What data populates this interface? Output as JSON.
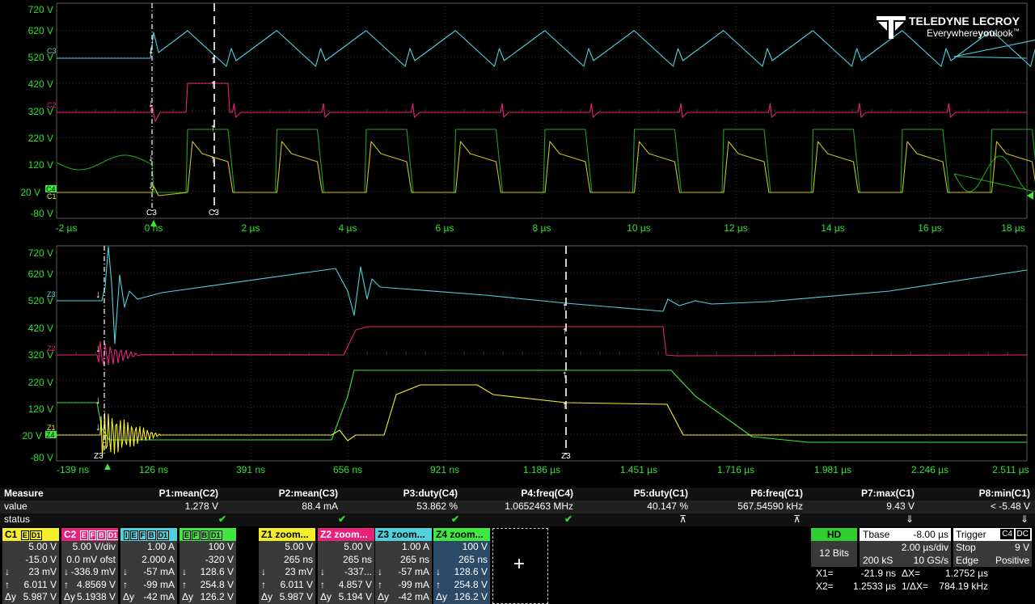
{
  "brand": {
    "name": "TELEDYNE LECROY",
    "tagline_a": "Everywhere",
    "tagline_b": "you",
    "tagline_c": "look",
    "tm": "™"
  },
  "colors": {
    "c1": "#f5ef2a",
    "c2": "#e8227a",
    "c3": "#4fd2de",
    "c4": "#3ee83e",
    "grid": "#5a5a5a",
    "axis": "#2fe02f"
  },
  "top": {
    "y_labels": [
      "720 V",
      "620 V",
      "520 V",
      "420 V",
      "320 V",
      "220 V",
      "120 V",
      "20 V",
      "-80 V"
    ],
    "x_labels": [
      "-2 µs",
      "0 ns",
      "2 µs",
      "4 µs",
      "6 µs",
      "8 µs",
      "10 µs",
      "12 µs",
      "14 µs",
      "16 µs",
      "18 µs"
    ],
    "markers": {
      "c3": "C3",
      "c2": "C2",
      "c4": "C4",
      "c1": "C1"
    },
    "cursor_labels": [
      "C3",
      "C3"
    ]
  },
  "bottom": {
    "y_labels": [
      "720 V",
      "620 V",
      "520 V",
      "420 V",
      "320 V",
      "220 V",
      "120 V",
      "20 V",
      "-80 V"
    ],
    "x_labels": [
      "-139 ns",
      "126 ns",
      "391 ns",
      "656 ns",
      "921 ns",
      "1.186 µs",
      "1.451 µs",
      "1.716 µs",
      "1.981 µs",
      "2.246 µs",
      "2.511 µs"
    ],
    "markers": {
      "z3": "Z3",
      "z2": "Z2",
      "z4": "Z4",
      "z1": "Z1"
    },
    "cursor_labels": [
      "Z3",
      "Z3"
    ]
  },
  "measure": {
    "head_label": "Measure",
    "value_label": "value",
    "status_label": "status",
    "params": [
      {
        "name": "P1:mean(C2)",
        "value": "1.278 V",
        "status": "✔"
      },
      {
        "name": "P2:mean(C3)",
        "value": "88.4 mA",
        "status": "✔"
      },
      {
        "name": "P3:duty(C4)",
        "value": "53.862 %",
        "status": "✔"
      },
      {
        "name": "P4:freq(C4)",
        "value": "1.0652463 MHz",
        "status": "✔"
      },
      {
        "name": "P5:duty(C1)",
        "value": "40.147 %",
        "status": "⊼"
      },
      {
        "name": "P6:freq(C1)",
        "value": "567.54590 kHz",
        "status": "⊼"
      },
      {
        "name": "P7:max(C1)",
        "value": "9.43 V",
        "status": "⇓"
      },
      {
        "name": "P8:min(C1)",
        "value": "< -5.48 V",
        "status": "⇓"
      }
    ]
  },
  "channels": [
    {
      "title": "C1",
      "tags": [
        "E",
        "D1"
      ],
      "color": "#f5ef2a",
      "rows": [
        [
          "",
          "5.00 V"
        ],
        [
          "",
          "-15.0 V"
        ],
        [
          "↓",
          "23 mV"
        ],
        [
          "↑",
          "6.011 V"
        ],
        [
          "Δy",
          "5.987 V"
        ]
      ]
    },
    {
      "title": "C2",
      "tags": [
        "E",
        "F",
        "B",
        "D1"
      ],
      "color": "#e8227a",
      "rows": [
        [
          "",
          "5.00 V/div"
        ],
        [
          "",
          "0.0 mV ofst"
        ],
        [
          "↓",
          "-336.9 mV"
        ],
        [
          "↑",
          "4.8569 V"
        ],
        [
          "Δy",
          "5.1938 V"
        ]
      ]
    },
    {
      "title": "",
      "tags": [
        "I",
        "E",
        "F",
        "B",
        "D1"
      ],
      "color": "#4fd2de",
      "rows": [
        [
          "",
          "1.00 A"
        ],
        [
          "",
          "2.000 A"
        ],
        [
          "↓",
          "-57 mA"
        ],
        [
          "↑",
          "-99 mA"
        ],
        [
          "Δy",
          "-42 mA"
        ]
      ]
    },
    {
      "title": "",
      "tags": [
        "E",
        "F",
        "B",
        "D1"
      ],
      "color": "#3ee83e",
      "rows": [
        [
          "",
          "100 V"
        ],
        [
          "",
          "-320 V"
        ],
        [
          "↓",
          "128.6 V"
        ],
        [
          "↑",
          "254.8 V"
        ],
        [
          "Δy",
          "126.2 V"
        ]
      ]
    },
    {
      "title": "Z1 zoom...",
      "tags": [],
      "color": "#f5ef2a",
      "rows": [
        [
          "",
          "5.00 V"
        ],
        [
          "",
          "265 ns"
        ],
        [
          "↓",
          "23 mV"
        ],
        [
          "↑",
          "6.011 V"
        ],
        [
          "Δy",
          "5.987 V"
        ]
      ]
    },
    {
      "title": "Z2 zoom...",
      "tags": [],
      "color": "#e8227a",
      "rows": [
        [
          "",
          "5.00 V"
        ],
        [
          "",
          "265 ns"
        ],
        [
          "↓",
          "-337..."
        ],
        [
          "↑",
          "4.857 V"
        ],
        [
          "Δy",
          "5.194 V"
        ]
      ]
    },
    {
      "title": "Z3 zoom...",
      "tags": [],
      "color": "#4fd2de",
      "rows": [
        [
          "",
          "1.00 A"
        ],
        [
          "",
          "265 ns"
        ],
        [
          "↓",
          "-57 mA"
        ],
        [
          "↑",
          "-99 mA"
        ],
        [
          "Δy",
          "-42 mA"
        ]
      ]
    },
    {
      "title": "Z4 zoom...",
      "tags": [],
      "color": "#3ee83e",
      "rows": [
        [
          "",
          "100 V"
        ],
        [
          "",
          "265 ns"
        ],
        [
          "↓",
          "128.6 V"
        ],
        [
          "↑",
          "254.8 V"
        ],
        [
          "Δy",
          "126.2 V"
        ]
      ]
    }
  ],
  "add_symbol": "+",
  "hd": {
    "label": "HD",
    "bits": "12 Bits"
  },
  "timebase": {
    "label": "Tbase",
    "offset": "-8.00 µs",
    "div": "2.00 µs/div",
    "samples": "200 kS",
    "rate": "10 GS/s"
  },
  "trigger": {
    "label": "Trigger",
    "ch": "C4",
    "coupling": "DC",
    "mode": "Stop",
    "level": "9 V",
    "type": "Edge",
    "slope": "Positive"
  },
  "cursors": {
    "x1_label": "X1=",
    "x1": "-21.9 ns",
    "dx_label": "ΔX=",
    "dx": "1.2752 µs",
    "x2_label": "X2=",
    "x2": "1.2533 µs",
    "idx_label": "1/ΔX=",
    "idx": "784.19 kHz"
  }
}
